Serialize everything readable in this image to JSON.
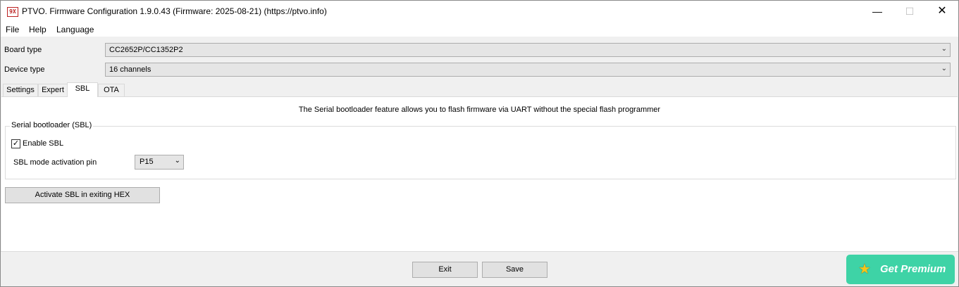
{
  "window": {
    "app_icon": "9X",
    "title": "PTVO. Firmware Configuration 1.9.0.43 (Firmware: 2025-08-21) (https://ptvo.info)",
    "minimize": "—",
    "maximize": "☐",
    "close": "✕"
  },
  "menu": {
    "file": "File",
    "help": "Help",
    "language": "Language"
  },
  "board_type": {
    "label": "Board type",
    "value": "CC2652P/CC1352P2"
  },
  "device_type": {
    "label": "Device type",
    "value": "16 channels"
  },
  "tabs": {
    "settings": "Settings",
    "expert": "Expert",
    "sbl": "SBL",
    "ota": "OTA"
  },
  "sbl_panel": {
    "info": "The Serial bootloader feature allows you to flash firmware via UART without the special flash programmer",
    "group_title": "Serial bootloader (SBL)",
    "enable_label": "Enable SBL",
    "enable_checked": true,
    "check_glyph": "✓",
    "pin_label": "SBL mode activation pin",
    "pin_value": "P15",
    "activate_button": "Activate SBL in exiting HEX"
  },
  "footer": {
    "exit": "Exit",
    "save": "Save",
    "premium": "Get Premium",
    "premium_icon": "★"
  },
  "dropdown_glyph": "⌄",
  "icons": {
    "app": "app-icon",
    "dropdown": "chevron-down-icon",
    "premium": "star-icon"
  }
}
